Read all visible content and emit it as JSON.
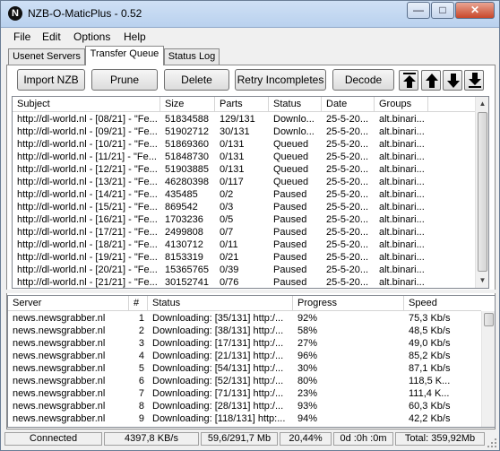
{
  "window": {
    "title": "NZB-O-MaticPlus - 0.52",
    "app_icon": "nzb-logo-icon"
  },
  "menu": [
    {
      "label": "File"
    },
    {
      "label": "Edit"
    },
    {
      "label": "Options"
    },
    {
      "label": "Help"
    }
  ],
  "tabs": [
    {
      "label": "Usenet Servers",
      "active": false
    },
    {
      "label": "Transfer Queue",
      "active": true
    },
    {
      "label": "Status Log",
      "active": false
    }
  ],
  "toolbar": {
    "import": "Import NZB",
    "prune": "Prune",
    "delete": "Delete",
    "retry": "Retry Incompletes",
    "decode": "Decode",
    "move_icons": [
      "move-top-icon",
      "move-up-icon",
      "move-down-icon",
      "move-bottom-icon"
    ]
  },
  "queue": {
    "columns": [
      "Subject",
      "Size",
      "Parts",
      "Status",
      "Date",
      "Groups"
    ],
    "rows": [
      [
        "http://dl-world.nl - [08/21] - \"Fe...",
        "51834588",
        "129/131",
        "Downlo...",
        "25-5-20...",
        "alt.binari..."
      ],
      [
        "http://dl-world.nl - [09/21] - \"Fe...",
        "51902712",
        "30/131",
        "Downlo...",
        "25-5-20...",
        "alt.binari..."
      ],
      [
        "http://dl-world.nl - [10/21] - \"Fe...",
        "51869360",
        "0/131",
        "Queued",
        "25-5-20...",
        "alt.binari..."
      ],
      [
        "http://dl-world.nl - [11/21] - \"Fe...",
        "51848730",
        "0/131",
        "Queued",
        "25-5-20...",
        "alt.binari..."
      ],
      [
        "http://dl-world.nl - [12/21] - \"Fe...",
        "51903885",
        "0/131",
        "Queued",
        "25-5-20...",
        "alt.binari..."
      ],
      [
        "http://dl-world.nl - [13/21] - \"Fe...",
        "46280398",
        "0/117",
        "Queued",
        "25-5-20...",
        "alt.binari..."
      ],
      [
        "http://dl-world.nl - [14/21] - \"Fe...",
        "435485",
        "0/2",
        "Paused",
        "25-5-20...",
        "alt.binari..."
      ],
      [
        "http://dl-world.nl - [15/21] - \"Fe...",
        "869542",
        "0/3",
        "Paused",
        "25-5-20...",
        "alt.binari..."
      ],
      [
        "http://dl-world.nl - [16/21] - \"Fe...",
        "1703236",
        "0/5",
        "Paused",
        "25-5-20...",
        "alt.binari..."
      ],
      [
        "http://dl-world.nl - [17/21] - \"Fe...",
        "2499808",
        "0/7",
        "Paused",
        "25-5-20...",
        "alt.binari..."
      ],
      [
        "http://dl-world.nl - [18/21] - \"Fe...",
        "4130712",
        "0/11",
        "Paused",
        "25-5-20...",
        "alt.binari..."
      ],
      [
        "http://dl-world.nl - [19/21] - \"Fe...",
        "8153319",
        "0/21",
        "Paused",
        "25-5-20...",
        "alt.binari..."
      ],
      [
        "http://dl-world.nl - [20/21] - \"Fe...",
        "15365765",
        "0/39",
        "Paused",
        "25-5-20...",
        "alt.binari..."
      ],
      [
        "http://dl-world.nl - [21/21] - \"Fe...",
        "30152741",
        "0/76",
        "Paused",
        "25-5-20...",
        "alt.binari..."
      ]
    ]
  },
  "connections": {
    "columns": [
      "Server",
      "#",
      "Status",
      "Progress",
      "Speed"
    ],
    "rows": [
      [
        "news.newsgrabber.nl",
        "1",
        "Downloading: [35/131] http:/...",
        "92%",
        "75,3 Kb/s"
      ],
      [
        "news.newsgrabber.nl",
        "2",
        "Downloading: [38/131] http:/...",
        "58%",
        "48,5 Kb/s"
      ],
      [
        "news.newsgrabber.nl",
        "3",
        "Downloading: [17/131] http:/...",
        "27%",
        "49,0 Kb/s"
      ],
      [
        "news.newsgrabber.nl",
        "4",
        "Downloading: [21/131] http:/...",
        "96%",
        "85,2 Kb/s"
      ],
      [
        "news.newsgrabber.nl",
        "5",
        "Downloading: [54/131] http:/...",
        "30%",
        "87,1 Kb/s"
      ],
      [
        "news.newsgrabber.nl",
        "6",
        "Downloading: [52/131] http:/...",
        "80%",
        "118,5 K..."
      ],
      [
        "news.newsgrabber.nl",
        "7",
        "Downloading: [71/131] http:/...",
        "23%",
        "111,4 K..."
      ],
      [
        "news.newsgrabber.nl",
        "8",
        "Downloading: [28/131] http:/...",
        "93%",
        "60,3 Kb/s"
      ],
      [
        "news.newsgrabber.nl",
        "9",
        "Downloading: [118/131] http:...",
        "94%",
        "42,2 Kb/s"
      ]
    ]
  },
  "statusbar": {
    "connection": "Connected",
    "speed": "4397,8 KB/s",
    "transferred": "59,6/291,7 Mb",
    "percent": "20,44%",
    "eta": "0d :0h :0m",
    "total": "Total: 359,92Mb"
  }
}
